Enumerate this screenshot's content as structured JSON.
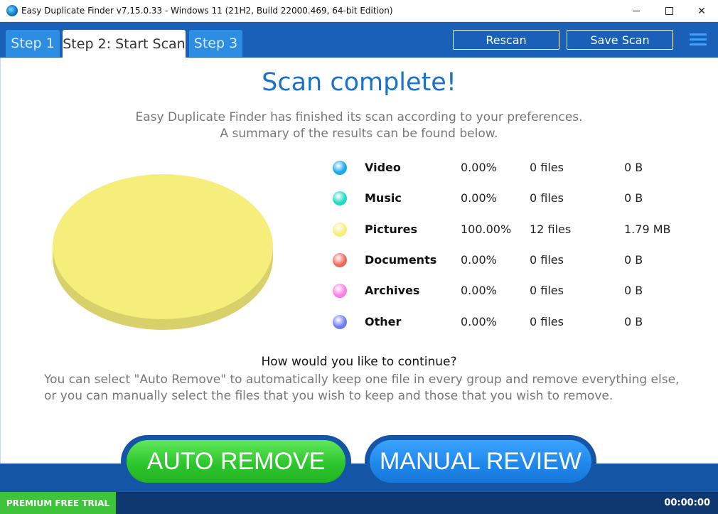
{
  "window": {
    "title": "Easy Duplicate Finder v7.15.0.33 - Windows 11 (21H2, Build 22000.469, 64-bit Edition)"
  },
  "tabs": [
    {
      "label": "Step 1"
    },
    {
      "label": "Step 2: Start Scan"
    },
    {
      "label": "Step 3"
    }
  ],
  "toolbar": {
    "rescan_label": "Rescan",
    "save_scan_label": "Save Scan"
  },
  "main": {
    "heading": "Scan complete!",
    "subtitle_line1": "Easy Duplicate Finder has finished its scan according to your preferences.",
    "subtitle_line2": "A summary of the results can be found below.",
    "question": "How would you like to continue?",
    "desc_line1": "You can select \"Auto Remove\" to automatically keep one file in every group and remove everything else,",
    "desc_line2": "or you can manually select the files that you wish to keep and those that you wish to remove."
  },
  "chart_data": {
    "type": "pie",
    "categories": [
      "Video",
      "Music",
      "Pictures",
      "Documents",
      "Archives",
      "Other"
    ],
    "values": [
      0,
      0,
      100,
      0,
      0,
      0
    ],
    "colors": [
      "#1aa6ec",
      "#20d8c2",
      "#f5ee7a",
      "#f0665a",
      "#f77fe6",
      "#6f7cf0"
    ]
  },
  "results": [
    {
      "name": "Video",
      "percent": "0.00%",
      "files": "0 files",
      "size": "0 B",
      "color": "#1aa6ec"
    },
    {
      "name": "Music",
      "percent": "0.00%",
      "files": "0 files",
      "size": "0 B",
      "color": "#20d8c2"
    },
    {
      "name": "Pictures",
      "percent": "100.00%",
      "files": "12 files",
      "size": "1.79 MB",
      "color": "#f5ee7a"
    },
    {
      "name": "Documents",
      "percent": "0.00%",
      "files": "0 files",
      "size": "0 B",
      "color": "#f0665a"
    },
    {
      "name": "Archives",
      "percent": "0.00%",
      "files": "0 files",
      "size": "0 B",
      "color": "#f77fe6"
    },
    {
      "name": "Other",
      "percent": "0.00%",
      "files": "0 files",
      "size": "0 B",
      "color": "#6f7cf0"
    }
  ],
  "actions": {
    "auto_remove": "AUTO REMOVE",
    "manual_review": "MANUAL REVIEW"
  },
  "status": {
    "trial": "PREMIUM FREE TRIAL",
    "timer": "00:00:00"
  }
}
